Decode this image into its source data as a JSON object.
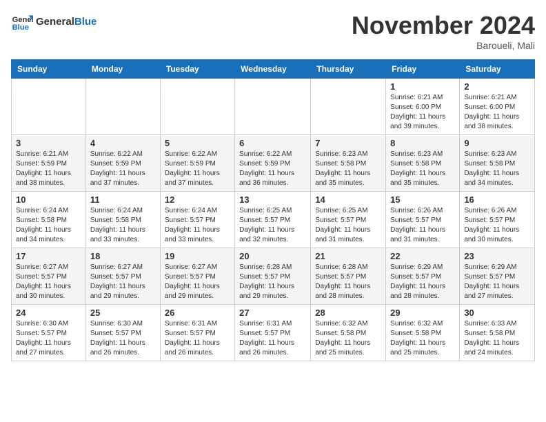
{
  "header": {
    "logo_line1": "General",
    "logo_line2": "Blue",
    "month_year": "November 2024",
    "location": "Baroueli, Mali"
  },
  "weekdays": [
    "Sunday",
    "Monday",
    "Tuesday",
    "Wednesday",
    "Thursday",
    "Friday",
    "Saturday"
  ],
  "weeks": [
    [
      {
        "day": "",
        "info": ""
      },
      {
        "day": "",
        "info": ""
      },
      {
        "day": "",
        "info": ""
      },
      {
        "day": "",
        "info": ""
      },
      {
        "day": "",
        "info": ""
      },
      {
        "day": "1",
        "info": "Sunrise: 6:21 AM\nSunset: 6:00 PM\nDaylight: 11 hours\nand 39 minutes."
      },
      {
        "day": "2",
        "info": "Sunrise: 6:21 AM\nSunset: 6:00 PM\nDaylight: 11 hours\nand 38 minutes."
      }
    ],
    [
      {
        "day": "3",
        "info": "Sunrise: 6:21 AM\nSunset: 5:59 PM\nDaylight: 11 hours\nand 38 minutes."
      },
      {
        "day": "4",
        "info": "Sunrise: 6:22 AM\nSunset: 5:59 PM\nDaylight: 11 hours\nand 37 minutes."
      },
      {
        "day": "5",
        "info": "Sunrise: 6:22 AM\nSunset: 5:59 PM\nDaylight: 11 hours\nand 37 minutes."
      },
      {
        "day": "6",
        "info": "Sunrise: 6:22 AM\nSunset: 5:59 PM\nDaylight: 11 hours\nand 36 minutes."
      },
      {
        "day": "7",
        "info": "Sunrise: 6:23 AM\nSunset: 5:58 PM\nDaylight: 11 hours\nand 35 minutes."
      },
      {
        "day": "8",
        "info": "Sunrise: 6:23 AM\nSunset: 5:58 PM\nDaylight: 11 hours\nand 35 minutes."
      },
      {
        "day": "9",
        "info": "Sunrise: 6:23 AM\nSunset: 5:58 PM\nDaylight: 11 hours\nand 34 minutes."
      }
    ],
    [
      {
        "day": "10",
        "info": "Sunrise: 6:24 AM\nSunset: 5:58 PM\nDaylight: 11 hours\nand 34 minutes."
      },
      {
        "day": "11",
        "info": "Sunrise: 6:24 AM\nSunset: 5:58 PM\nDaylight: 11 hours\nand 33 minutes."
      },
      {
        "day": "12",
        "info": "Sunrise: 6:24 AM\nSunset: 5:57 PM\nDaylight: 11 hours\nand 33 minutes."
      },
      {
        "day": "13",
        "info": "Sunrise: 6:25 AM\nSunset: 5:57 PM\nDaylight: 11 hours\nand 32 minutes."
      },
      {
        "day": "14",
        "info": "Sunrise: 6:25 AM\nSunset: 5:57 PM\nDaylight: 11 hours\nand 31 minutes."
      },
      {
        "day": "15",
        "info": "Sunrise: 6:26 AM\nSunset: 5:57 PM\nDaylight: 11 hours\nand 31 minutes."
      },
      {
        "day": "16",
        "info": "Sunrise: 6:26 AM\nSunset: 5:57 PM\nDaylight: 11 hours\nand 30 minutes."
      }
    ],
    [
      {
        "day": "17",
        "info": "Sunrise: 6:27 AM\nSunset: 5:57 PM\nDaylight: 11 hours\nand 30 minutes."
      },
      {
        "day": "18",
        "info": "Sunrise: 6:27 AM\nSunset: 5:57 PM\nDaylight: 11 hours\nand 29 minutes."
      },
      {
        "day": "19",
        "info": "Sunrise: 6:27 AM\nSunset: 5:57 PM\nDaylight: 11 hours\nand 29 minutes."
      },
      {
        "day": "20",
        "info": "Sunrise: 6:28 AM\nSunset: 5:57 PM\nDaylight: 11 hours\nand 29 minutes."
      },
      {
        "day": "21",
        "info": "Sunrise: 6:28 AM\nSunset: 5:57 PM\nDaylight: 11 hours\nand 28 minutes."
      },
      {
        "day": "22",
        "info": "Sunrise: 6:29 AM\nSunset: 5:57 PM\nDaylight: 11 hours\nand 28 minutes."
      },
      {
        "day": "23",
        "info": "Sunrise: 6:29 AM\nSunset: 5:57 PM\nDaylight: 11 hours\nand 27 minutes."
      }
    ],
    [
      {
        "day": "24",
        "info": "Sunrise: 6:30 AM\nSunset: 5:57 PM\nDaylight: 11 hours\nand 27 minutes."
      },
      {
        "day": "25",
        "info": "Sunrise: 6:30 AM\nSunset: 5:57 PM\nDaylight: 11 hours\nand 26 minutes."
      },
      {
        "day": "26",
        "info": "Sunrise: 6:31 AM\nSunset: 5:57 PM\nDaylight: 11 hours\nand 26 minutes."
      },
      {
        "day": "27",
        "info": "Sunrise: 6:31 AM\nSunset: 5:57 PM\nDaylight: 11 hours\nand 26 minutes."
      },
      {
        "day": "28",
        "info": "Sunrise: 6:32 AM\nSunset: 5:58 PM\nDaylight: 11 hours\nand 25 minutes."
      },
      {
        "day": "29",
        "info": "Sunrise: 6:32 AM\nSunset: 5:58 PM\nDaylight: 11 hours\nand 25 minutes."
      },
      {
        "day": "30",
        "info": "Sunrise: 6:33 AM\nSunset: 5:58 PM\nDaylight: 11 hours\nand 24 minutes."
      }
    ]
  ]
}
